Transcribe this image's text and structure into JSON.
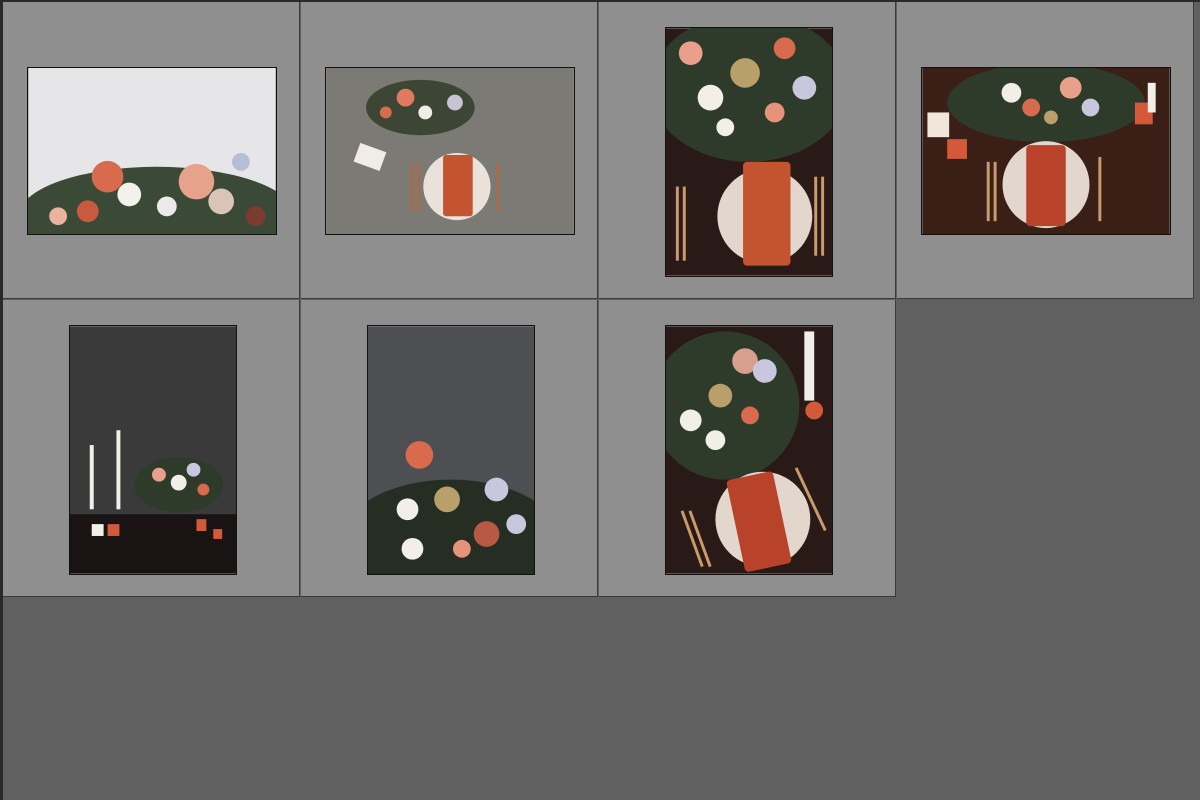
{
  "app": {
    "view": "Grid"
  },
  "colors": {
    "panel_background": "#606060",
    "cell_background": "#8f8f8f",
    "cell_border": "#3a3a3a",
    "thumb_border": "#111111",
    "accent_rust": "#c4532f"
  },
  "thumbnails": [
    {
      "index": 1,
      "orientation": "landscape",
      "subject": "floral-arrangement-white-backdrop"
    },
    {
      "index": 2,
      "orientation": "landscape",
      "subject": "table-setting-concrete-floor"
    },
    {
      "index": 3,
      "orientation": "portrait",
      "subject": "table-setting-overhead"
    },
    {
      "index": 4,
      "orientation": "landscape",
      "subject": "table-setting-candles"
    },
    {
      "index": 5,
      "orientation": "portrait",
      "subject": "candles-and-flowers-dark"
    },
    {
      "index": 6,
      "orientation": "portrait",
      "subject": "flowers-dark-backdrop"
    },
    {
      "index": 7,
      "orientation": "portrait",
      "subject": "table-setting-candle-overhead"
    }
  ]
}
